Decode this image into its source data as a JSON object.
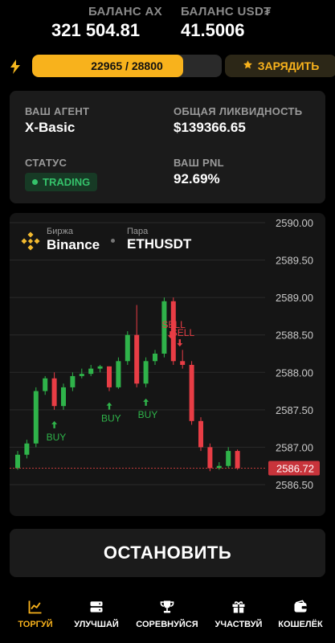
{
  "header": {
    "ax_label": "БАЛАНС AX",
    "ax_value": "321 504.81",
    "usdt_label": "БАЛАНС USD₮",
    "usdt_value": "41.5006"
  },
  "energy": {
    "icon": "lightning-icon",
    "current": 22965,
    "max": 28800,
    "text": "22965 / 28800",
    "fill_fraction": 0.797,
    "charge_label": "ЗАРЯДИТЬ",
    "charge_icon": "star-icon"
  },
  "agent": {
    "agent_label": "ВАШ АГЕНТ",
    "agent_value": "X-Basic",
    "liquidity_label": "ОБЩАЯ ЛИКВИДНОСТЬ",
    "liquidity_value": "$139366.65",
    "status_label": "СТАТУС",
    "status_value": "TRADING",
    "pnl_label": "ВАШ PNL",
    "pnl_value": "92.69%"
  },
  "market": {
    "exchange_label": "Биржа",
    "exchange_value": "Binance",
    "pair_label": "Пара",
    "pair_value": "ETHUSDT"
  },
  "chart_data": {
    "type": "candlestick",
    "ylim": [
      2586.3,
      2590.0
    ],
    "y_ticks": [
      "2590.00",
      "2589.50",
      "2589.00",
      "2588.50",
      "2588.00",
      "2587.50",
      "2587.00",
      "2586.50"
    ],
    "y_tick_values": [
      2590.0,
      2589.5,
      2589.0,
      2588.5,
      2588.0,
      2587.5,
      2587.0,
      2586.5
    ],
    "current_price": 2586.72,
    "current_price_label": "2586.72",
    "colors": {
      "up": "#2fb34a",
      "down": "#e83d45",
      "price_line": "#c23a3a",
      "grid": "#2b2b2b"
    },
    "candles": [
      {
        "o": 2586.72,
        "h": 2586.95,
        "c": 2586.9,
        "l": 2586.7
      },
      {
        "o": 2586.9,
        "h": 2587.1,
        "c": 2587.05,
        "l": 2586.85
      },
      {
        "o": 2587.05,
        "h": 2587.8,
        "c": 2587.75,
        "l": 2587.0
      },
      {
        "o": 2587.75,
        "h": 2587.95,
        "c": 2587.92,
        "l": 2587.7
      },
      {
        "o": 2587.92,
        "h": 2588.0,
        "c": 2587.55,
        "l": 2587.5
      },
      {
        "o": 2587.55,
        "h": 2587.85,
        "c": 2587.8,
        "l": 2587.5
      },
      {
        "o": 2587.8,
        "h": 2588.0,
        "c": 2587.95,
        "l": 2587.75
      },
      {
        "o": 2587.95,
        "h": 2588.05,
        "c": 2587.98,
        "l": 2587.92
      },
      {
        "o": 2587.98,
        "h": 2588.1,
        "c": 2588.05,
        "l": 2587.95
      },
      {
        "o": 2588.05,
        "h": 2588.1,
        "c": 2588.08,
        "l": 2588.0
      },
      {
        "o": 2588.08,
        "h": 2588.08,
        "c": 2587.8,
        "l": 2587.75
      },
      {
        "o": 2587.8,
        "h": 2588.2,
        "c": 2588.15,
        "l": 2587.78
      },
      {
        "o": 2588.15,
        "h": 2588.55,
        "c": 2588.5,
        "l": 2588.1
      },
      {
        "o": 2588.5,
        "h": 2588.9,
        "c": 2587.85,
        "l": 2587.8
      },
      {
        "o": 2587.85,
        "h": 2588.2,
        "c": 2588.15,
        "l": 2587.8
      },
      {
        "o": 2588.15,
        "h": 2588.3,
        "c": 2588.25,
        "l": 2588.1
      },
      {
        "o": 2588.25,
        "h": 2589.0,
        "c": 2588.95,
        "l": 2588.2
      },
      {
        "o": 2588.95,
        "h": 2589.0,
        "c": 2588.15,
        "l": 2588.1
      },
      {
        "o": 2588.15,
        "h": 2588.3,
        "c": 2588.1,
        "l": 2588.05
      },
      {
        "o": 2588.1,
        "h": 2588.15,
        "c": 2587.35,
        "l": 2587.3
      },
      {
        "o": 2587.35,
        "h": 2587.4,
        "c": 2587.0,
        "l": 2586.95
      },
      {
        "o": 2587.0,
        "h": 2587.05,
        "c": 2586.72,
        "l": 2586.68
      },
      {
        "o": 2586.72,
        "h": 2586.8,
        "c": 2586.75,
        "l": 2586.7
      },
      {
        "o": 2586.75,
        "h": 2587.0,
        "c": 2586.95,
        "l": 2586.72
      },
      {
        "o": 2586.95,
        "h": 2586.97,
        "c": 2586.72,
        "l": 2586.7
      }
    ],
    "signals": [
      {
        "label": "BUY",
        "type": "buy",
        "candle": 4
      },
      {
        "label": "BUY",
        "type": "buy",
        "candle": 10
      },
      {
        "label": "BUY",
        "type": "buy",
        "candle": 14
      },
      {
        "label": "SELL",
        "type": "sell",
        "candle": 16
      },
      {
        "label": "SELL",
        "type": "sell",
        "candle": 17
      }
    ]
  },
  "actions": {
    "stop_label": "ОСТАНОВИТЬ"
  },
  "nav": {
    "items": [
      {
        "label": "ТОРГУЙ",
        "icon": "chart-icon",
        "active": true
      },
      {
        "label": "УЛУЧШАЙ",
        "icon": "server-icon",
        "active": false
      },
      {
        "label": "СОРЕВНУЙСЯ",
        "icon": "trophy-icon",
        "active": false
      },
      {
        "label": "УЧАСТВУЙ",
        "icon": "gift-icon",
        "active": false
      },
      {
        "label": "КОШЕЛЁК",
        "icon": "wallet-icon",
        "active": false
      }
    ]
  }
}
